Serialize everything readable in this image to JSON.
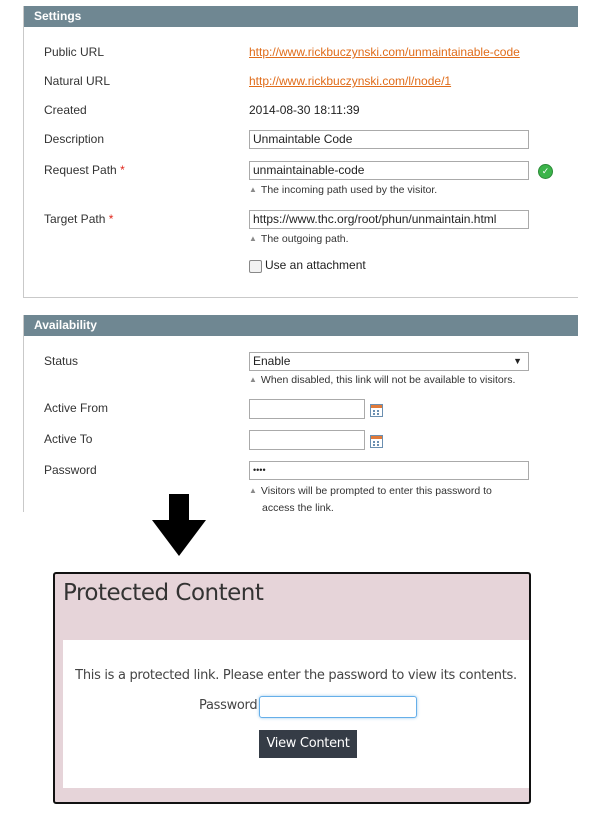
{
  "settings": {
    "header": "Settings",
    "public_url_label": "Public URL",
    "public_url": "http://www.rickbuczynski.com/unmaintainable-code",
    "natural_url_label": "Natural URL",
    "natural_url": "http://www.rickbuczynski.com/l/node/1",
    "created_label": "Created",
    "created": "2014-08-30 18:11:39",
    "description_label": "Description",
    "description": "Unmaintable Code",
    "request_path_label": "Request Path",
    "request_path": "unmaintainable-code",
    "request_path_hint": "The incoming path used by the visitor.",
    "target_path_label": "Target Path",
    "target_path": "https://www.thc.org/root/phun/unmaintain.html",
    "target_path_hint": "The outgoing path.",
    "attachment_label": "Use an attachment",
    "required_marker": "*"
  },
  "availability": {
    "header": "Availability",
    "status_label": "Status",
    "status_value": "Enable",
    "status_hint": "When disabled, this link will not be available to visitors.",
    "active_from_label": "Active From",
    "active_from": "",
    "active_to_label": "Active To",
    "active_to": "",
    "password_label": "Password",
    "password_value": "••••",
    "password_hint_line1": "Visitors will be prompted to enter this password to",
    "password_hint_line2": "access the link."
  },
  "protected": {
    "title": "Protected Content",
    "message": "This is a protected link. Please enter the password to view its contents.",
    "password_label": "Password",
    "password_value": "",
    "button": "View Content"
  },
  "icons": {
    "valid": "check-circle-icon",
    "calendar": "calendar-icon",
    "flow": "arrow-down-icon",
    "hint": "triangle-up-icon"
  },
  "colors": {
    "panel_header": "#6f8792",
    "link": "#e06c1a",
    "valid": "#3bb44a",
    "card_bg": "#e6d4d9",
    "button_bg": "#353c46",
    "required": "#e0261b"
  }
}
